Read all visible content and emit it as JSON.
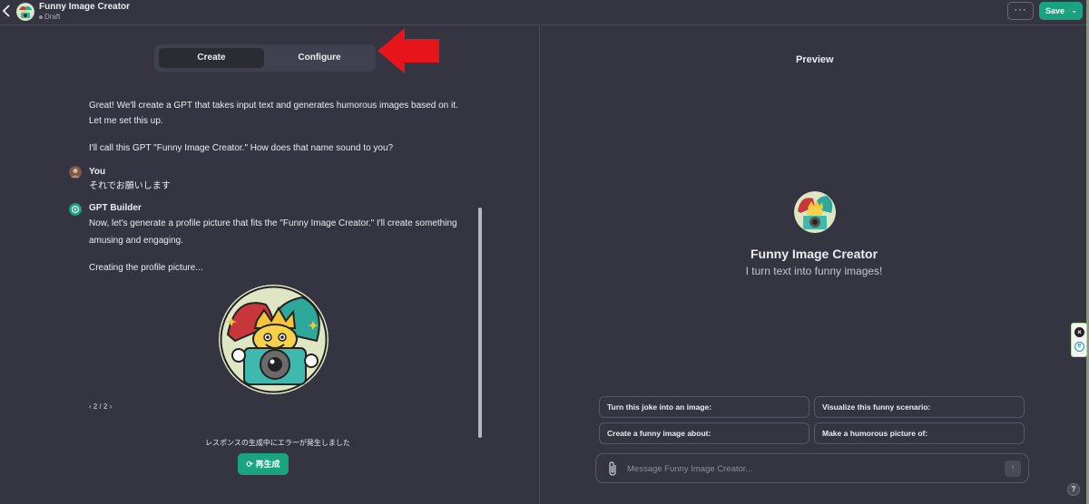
{
  "header": {
    "back_icon": "chevron-left-icon",
    "title": "Funny Image Creator",
    "status": "Draft",
    "more_label": "···",
    "save_label": "Save",
    "save_caret": "⌄"
  },
  "tabs": [
    {
      "label": "Create",
      "active": true
    },
    {
      "label": "Configure",
      "active": false
    }
  ],
  "annotation": {
    "arrow_color": "#e8141b"
  },
  "conversation": {
    "builder_message_1_line_1": "Great! We'll create a GPT that takes input text and generates humorous images based on it.",
    "builder_message_1_line_2": "Let me set this up.",
    "builder_message_2": "I'll call this GPT \"Funny Image Creator.\" How does that name sound to you?",
    "user_name": "You",
    "user_message": "それでお願いします",
    "builder_name": "GPT Builder",
    "builder_message_3_line_1": "Now, let's generate a profile picture that fits the \"Funny Image Creator.\" I'll create something",
    "builder_message_3_line_2": "amusing and engaging.",
    "builder_message_4": "Creating the profile picture...",
    "pager": "‹  2 / 2  ›",
    "error_text": "レスポンスの生成中にエラーが発生しました",
    "regenerate_label": "再生成"
  },
  "preview": {
    "title": "Preview",
    "gpt_name": "Funny Image Creator",
    "gpt_description": "I turn text into funny images!",
    "starters": [
      "Turn this joke into an image:",
      "Visualize this funny scenario:",
      "Create a funny image about:",
      "Make a humorous picture of:"
    ],
    "composer_placeholder": "Message Funny Image Creator...",
    "send_icon": "↑"
  },
  "help_label": "?",
  "colors": {
    "background": "#343541",
    "accent": "#19a37f",
    "text": "#ececf1"
  }
}
